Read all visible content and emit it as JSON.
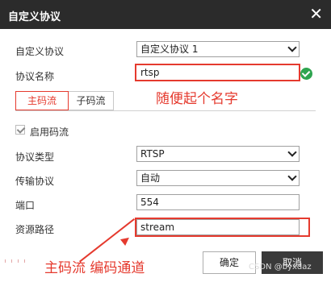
{
  "dialog": {
    "title": "自定义协议"
  },
  "fields": {
    "custom_protocol": {
      "label": "自定义协议",
      "value": "自定义协议 1"
    },
    "protocol_name": {
      "label": "协议名称",
      "value": "rtsp"
    },
    "enable_stream": {
      "label": "启用码流",
      "checked": true
    },
    "protocol_type": {
      "label": "协议类型",
      "value": "RTSP"
    },
    "transport": {
      "label": "传输协议",
      "value": "自动"
    },
    "port": {
      "label": "端口",
      "value": "554"
    },
    "resource_path": {
      "label": "资源路径",
      "value": "stream"
    }
  },
  "tabs": [
    {
      "label": "主码流",
      "active": true
    },
    {
      "label": "子码流",
      "active": false
    }
  ],
  "annotations": {
    "name_hint": "随便起个名字",
    "path_hint": "主码流 编码通道"
  },
  "buttons": {
    "ok": "确定",
    "cancel": "取消"
  },
  "watermark": "CSDN @byxdaz",
  "colors": {
    "annotation": "#e53a2e",
    "titlebar": "#2b2b2b",
    "valid": "#2ea44f"
  },
  "icons": {
    "close": "close-icon",
    "valid": "check-circle-icon",
    "dropdown": "chevron-down-icon"
  }
}
